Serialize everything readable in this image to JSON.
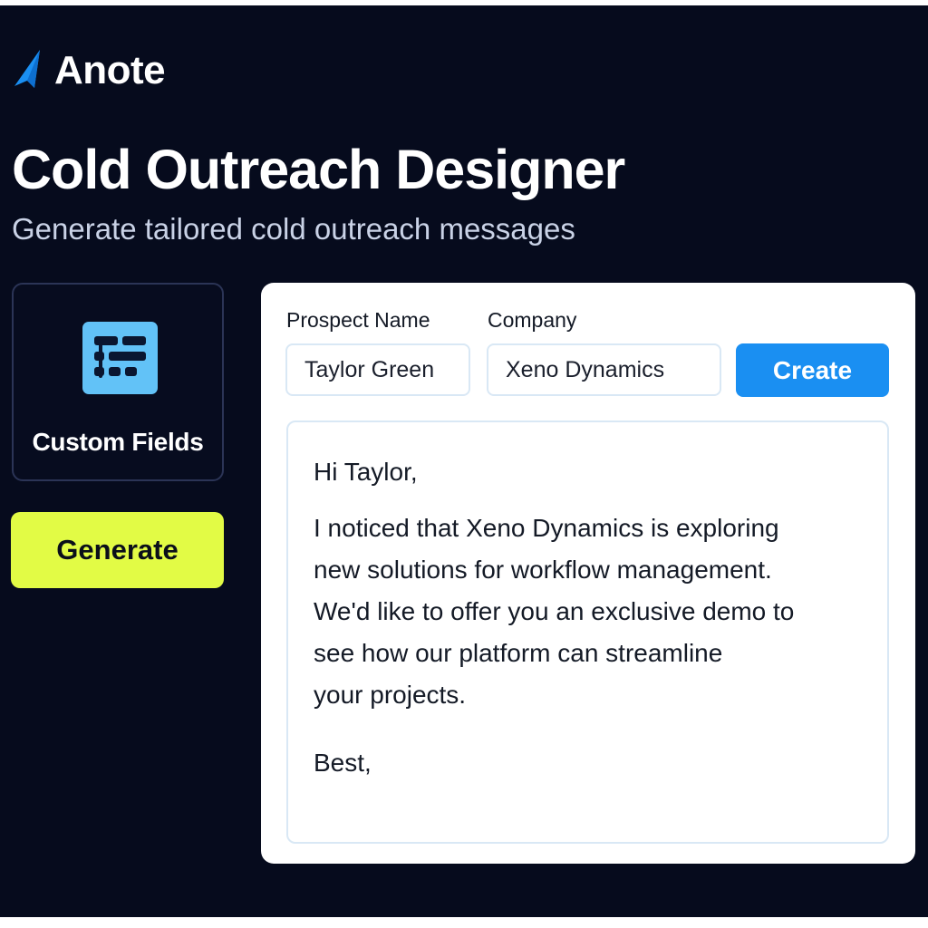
{
  "brand": {
    "name": "Anote",
    "logo_color": "#1a8ff2"
  },
  "header": {
    "title": "Cold Outreach Designer",
    "subtitle": "Generate tailored cold outreach messages"
  },
  "sidebar": {
    "custom_fields": {
      "label": "Custom Fields",
      "icon": "form-fields-icon",
      "icon_color": "#62c2f7"
    },
    "generate_label": "Generate",
    "generate_color": "#e2fb45"
  },
  "form": {
    "prospect_name": {
      "label": "Prospect Name",
      "value": "Taylor Green"
    },
    "company": {
      "label": "Company",
      "value": "Xeno Dynamics"
    },
    "create_label": "Create",
    "create_color": "#1a8ff2"
  },
  "message": {
    "greeting": "Hi Taylor,",
    "body_lines": [
      "I noticed that Xeno Dynamics is exploring",
      "new solutions for workflow management.",
      "We'd like to offer you an exclusive demo to",
      "see how our platform can streamline",
      "your projects."
    ],
    "signoff": "Best,"
  }
}
